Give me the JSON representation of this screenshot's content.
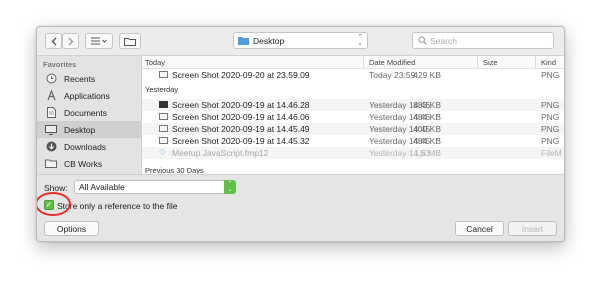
{
  "toolbar": {
    "back_icon": "chevron-left-icon",
    "forward_icon": "chevron-right-icon",
    "view_icon": "list-view-icon",
    "new_folder_icon": "new-folder-icon",
    "location": "Desktop",
    "search_placeholder": "Search"
  },
  "sidebar": {
    "heading": "Favorites",
    "items": [
      {
        "label": "Recents",
        "icon": "clock-icon"
      },
      {
        "label": "Applications",
        "icon": "applications-icon"
      },
      {
        "label": "Documents",
        "icon": "document-icon"
      },
      {
        "label": "Desktop",
        "icon": "desktop-icon",
        "selected": true
      },
      {
        "label": "Downloads",
        "icon": "download-icon"
      },
      {
        "label": "CB Works",
        "icon": "folder-icon"
      }
    ]
  },
  "columns": {
    "name": "Today",
    "date": "Date Modified",
    "size": "Size",
    "kind": "Kind"
  },
  "groups": {
    "yesterday": "Yesterday",
    "previous": "Previous 30 Days"
  },
  "rows": [
    {
      "name": "Screen Shot 2020-09-20 at 23.59.09",
      "date": "Today 23:59",
      "size": "429 KB",
      "kind": "PNG"
    },
    {
      "name": "Screen Shot 2020-09-19 at 14.46.28",
      "date": "Yesterday 14:46",
      "size": "883 KB",
      "kind": "PNG"
    },
    {
      "name": "Screen Shot 2020-09-19 at 14.46.06",
      "date": "Yesterday 14:46",
      "size": "484 KB",
      "kind": "PNG"
    },
    {
      "name": "Screen Shot 2020-09-19 at 14.45.49",
      "date": "Yesterday 14:45",
      "size": "400 KB",
      "kind": "PNG"
    },
    {
      "name": "Screen Shot 2020-09-19 at 14.45.32",
      "date": "Yesterday 14:45",
      "size": "484 KB",
      "kind": "PNG"
    },
    {
      "name": "Meetup JavaScript.fmp12",
      "date": "Yesterday 14:53",
      "size": "1,6 MB",
      "kind": "FileM"
    }
  ],
  "options": {
    "show_label": "Show:",
    "show_value": "All Available",
    "store_reference_label": "Store only a reference to the file",
    "store_reference_checked": true,
    "options_button": "Options",
    "cancel_button": "Cancel",
    "insert_button": "Insert"
  },
  "colors": {
    "accent_green": "#5fbf46",
    "annotation_red": "#e0322b",
    "folder_blue": "#4a9ee0"
  }
}
